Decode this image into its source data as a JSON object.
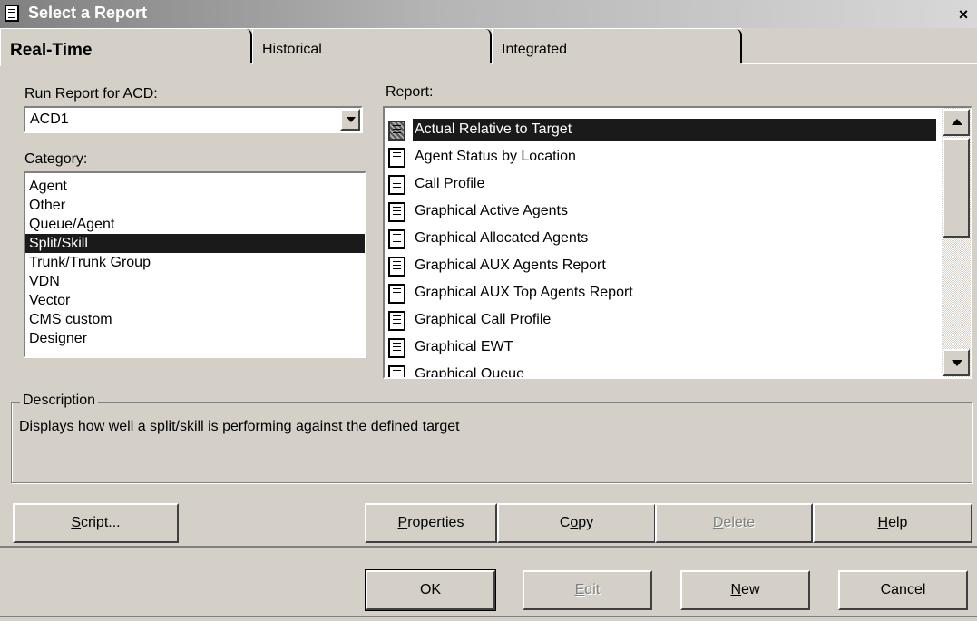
{
  "window": {
    "title": "Select a Report",
    "close_glyph": "×"
  },
  "tabs": [
    {
      "label": "Real-Time",
      "active": true
    },
    {
      "label": "Historical",
      "active": false
    },
    {
      "label": "Integrated",
      "active": false
    }
  ],
  "acd": {
    "label": "Run Report for ACD:",
    "value": "ACD1"
  },
  "category": {
    "label": "Category:",
    "items": [
      "Agent",
      "Other",
      "Queue/Agent",
      "Split/Skill",
      "Trunk/Trunk Group",
      "VDN",
      "Vector",
      "CMS custom",
      "Designer"
    ],
    "selected_index": 3
  },
  "report": {
    "label": "Report:",
    "items": [
      "Actual Relative to Target",
      "Agent Status by Location",
      "Call Profile",
      "Graphical Active Agents",
      "Graphical Allocated Agents",
      "Graphical AUX Agents Report",
      "Graphical AUX Top Agents Report",
      "Graphical Call Profile",
      "Graphical EWT",
      "Graphical Queue"
    ],
    "selected_index": 0
  },
  "description": {
    "legend": "Description",
    "text": "Displays how well a split/skill is performing against the defined target"
  },
  "buttons": {
    "script": "Script...",
    "properties": "Properties",
    "copy": "Copy",
    "delete": "Delete",
    "help": "Help",
    "ok": "OK",
    "edit": "Edit",
    "new": "New",
    "cancel": "Cancel"
  },
  "colors": {
    "face": "#d4d0c8",
    "selection": "#1a1a1a",
    "disabled_text": "#808080"
  }
}
